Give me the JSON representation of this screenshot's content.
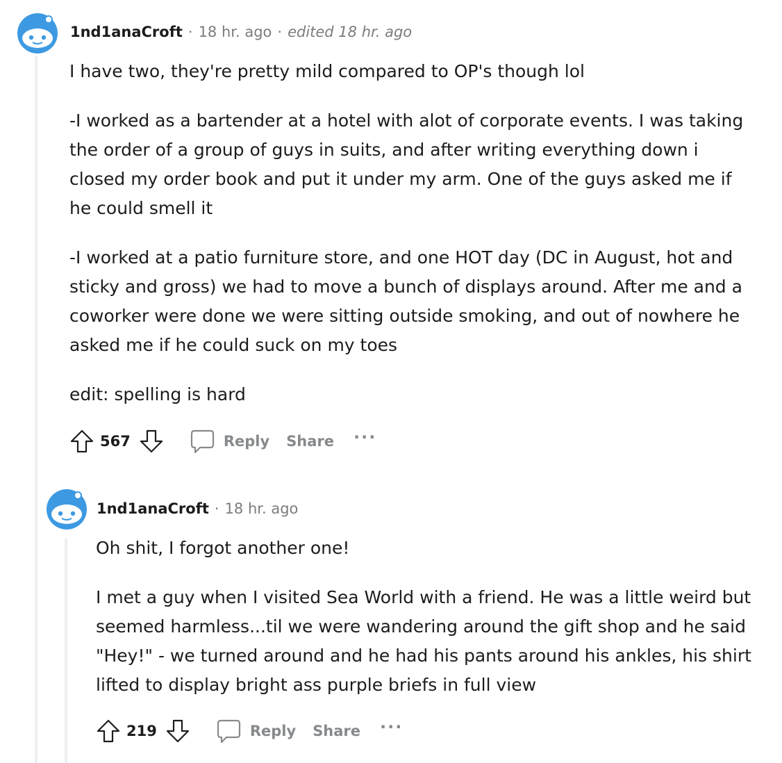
{
  "comments": [
    {
      "username": "1nd1anaCroft",
      "time": "18 hr. ago",
      "edited": "edited 18 hr. ago",
      "paragraphs": [
        "I have two, they're pretty mild compared to OP's though lol",
        "-I worked as a bartender at a hotel with alot of corporate events. I was taking the order of a group of guys in suits, and after writing everything down i closed my order book and put it under my arm. One of the guys asked me if he could smell it",
        "-I worked at a patio furniture store, and one HOT day (DC in August, hot and sticky and gross) we had to move a bunch of displays around. After me and a coworker were done we were sitting outside smoking, and out of nowhere he asked me if he could suck on my toes",
        "edit: spelling is hard"
      ],
      "score": "567",
      "reply_label": "Reply",
      "share_label": "Share",
      "more_label": "···"
    },
    {
      "username": "1nd1anaCroft",
      "time": "18 hr. ago",
      "paragraphs": [
        "Oh shit, I forgot another one!",
        "I met a guy when I visited Sea World with a friend. He was a little weird but seemed harmless...til we were wandering around the gift shop and he said \"Hey!\" - we turned around and he had his pants around his ankles, his shirt lifted to display bright ass purple briefs in full view"
      ],
      "score": "219",
      "reply_label": "Reply",
      "share_label": "Share",
      "more_label": "···"
    }
  ],
  "colors": {
    "avatar_blue": "#3d9ae2",
    "thread_line": "#edeff1",
    "meta_gray": "#7c7c7c"
  }
}
